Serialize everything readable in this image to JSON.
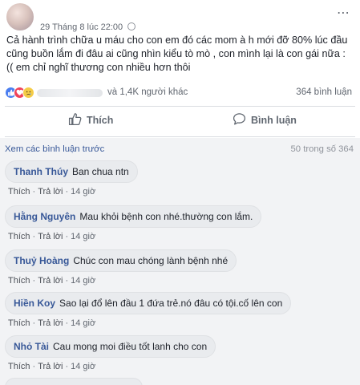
{
  "post": {
    "timestamp": "29 Tháng 8 lúc 22:00",
    "text": "Cả hành trình chữa u máu cho con em đó các mom à h mới đỡ 80% lúc đầu cũng buồn lắm đi đâu ai cũng nhìn kiểu tò mò , con mình lại là con gái nữa : (( em chỉ nghĩ thương con nhiều hơn thôi",
    "more_icon": "⋯"
  },
  "reactions": {
    "icons": [
      "like-icon",
      "love-icon",
      "sad-icon"
    ],
    "others": "và 1,4K người khác",
    "comment_count": "364 bình luận"
  },
  "actions": {
    "like_label": "Thích",
    "comment_label": "Bình luận"
  },
  "comments_section": {
    "view_previous": "Xem các bình luận trước",
    "count": "50 trong số 364",
    "like_label": "Thích",
    "reply_label": "Trả lời",
    "items": [
      {
        "author": "Thanh Thúy",
        "text": "Ban chua ntn",
        "time": "14 giờ"
      },
      {
        "author": "Hằng Nguyên",
        "text": "Mau khỏi bệnh con nhé.thường con lắm.",
        "time": "14 giờ"
      },
      {
        "author": "Thuỷ Hoàng",
        "text": "Chúc con mau chóng lành bệnh nhé",
        "time": "14 giờ"
      },
      {
        "author": "Hiền Koy",
        "text": "Sao lại đổ lên đầu 1 đứa trẻ.nó đâu có tội.cố lên con",
        "time": "14 giờ"
      },
      {
        "author": "Nhỏ Tài",
        "text": "Cau mong moi điều tốt lanh cho con",
        "time": "14 giờ"
      }
    ]
  },
  "colors": {
    "link": "#385898",
    "muted": "#616770",
    "comments_bg": "#f2f3f5",
    "bubble_bg": "#e9ebee",
    "like_blue": "#4a7ef0",
    "love_red": "#f0435a",
    "sad_yellow": "#f5cc47"
  }
}
